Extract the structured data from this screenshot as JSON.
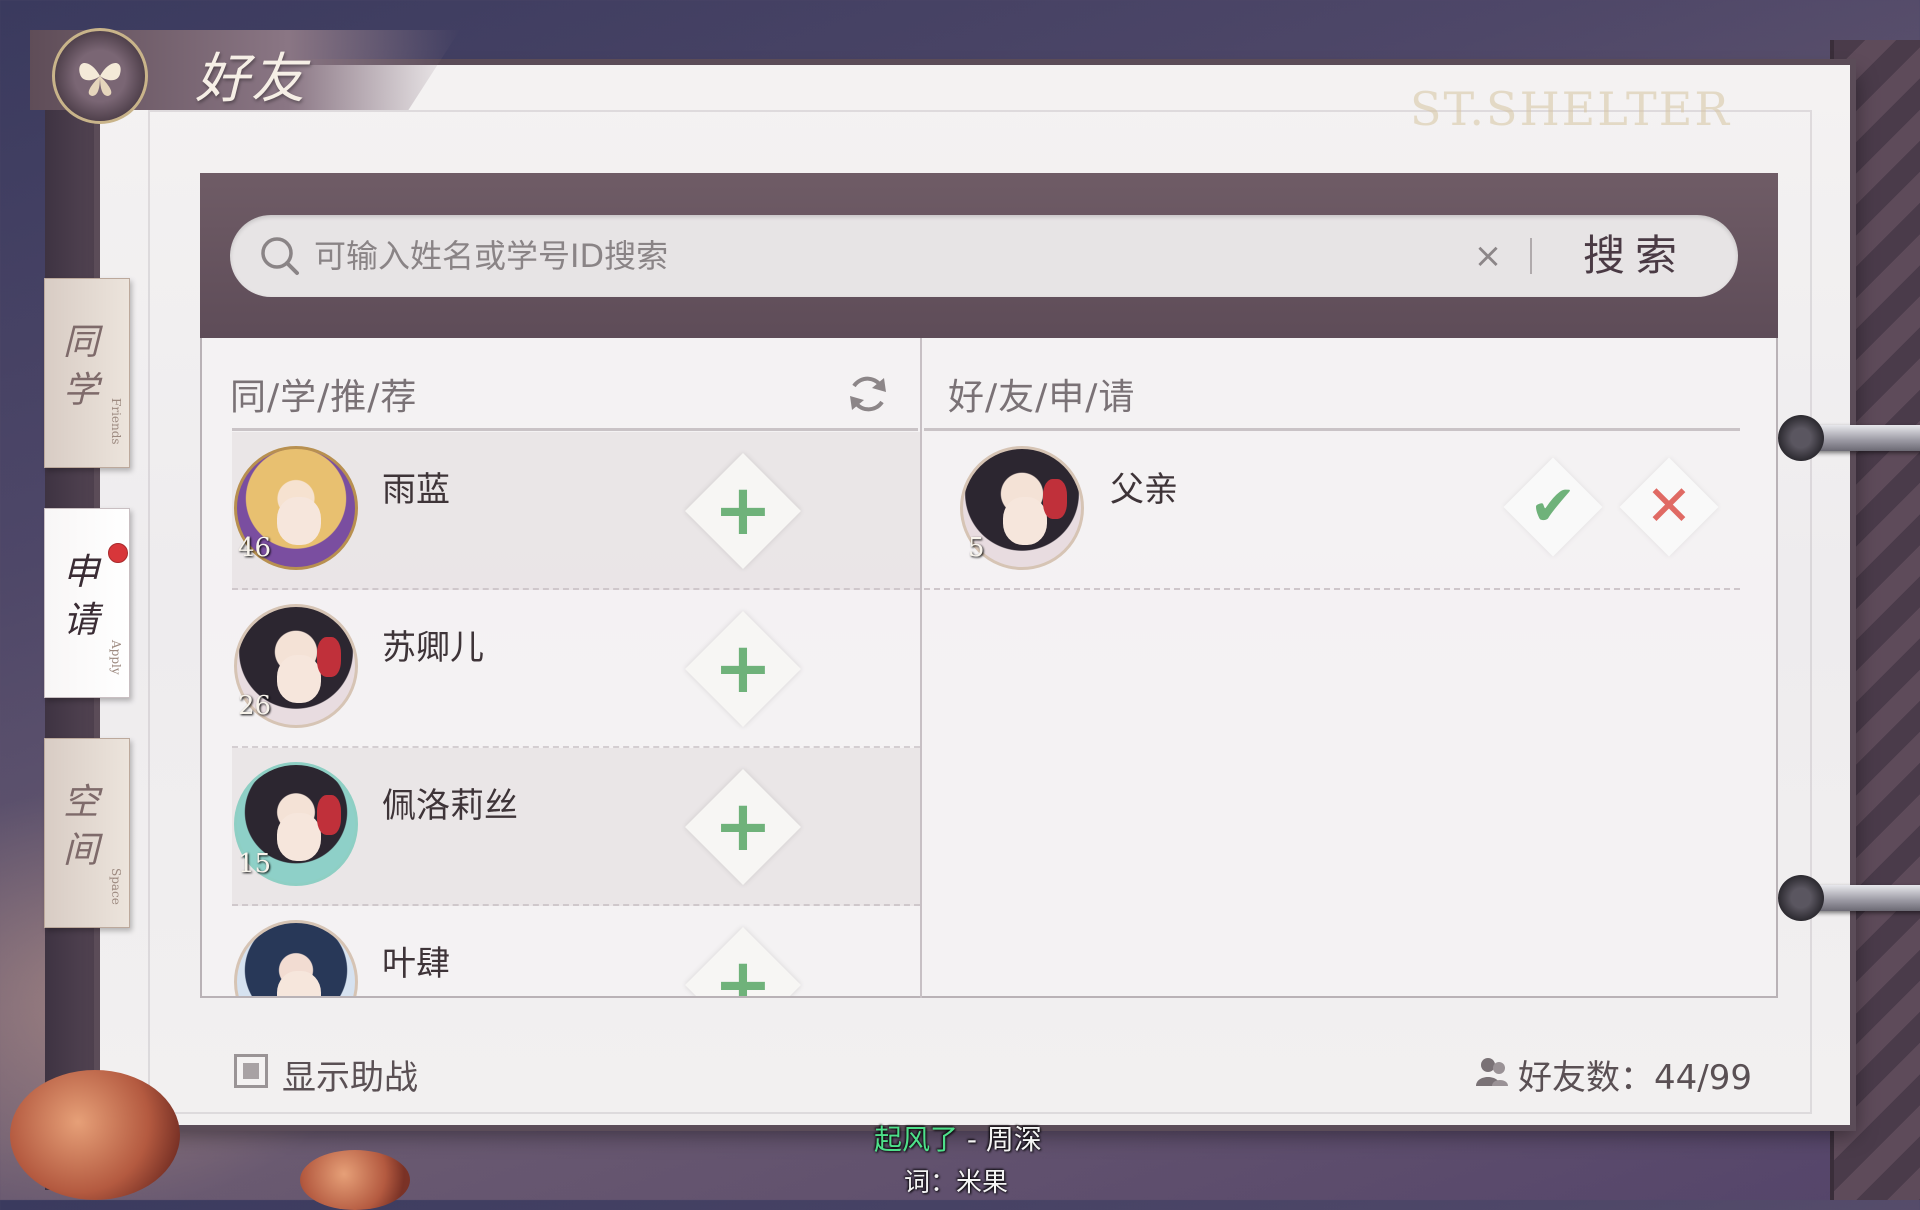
{
  "screen": {
    "title": "好友",
    "logo_text": "ST.SHELTER"
  },
  "side_tabs": [
    {
      "label_cn": "同学",
      "label_en": "Friends",
      "active": false
    },
    {
      "label_cn": "申请",
      "label_en": "Apply",
      "active": true,
      "notification": true
    },
    {
      "label_cn": "空间",
      "label_en": "Space",
      "active": false
    }
  ],
  "search": {
    "placeholder": "可输入姓名或学号ID搜索",
    "clear_icon": "close-icon",
    "button_label": "搜索"
  },
  "recommend": {
    "title": "同/学/推/荐",
    "refresh_icon": "refresh-icon",
    "items": [
      {
        "name": "雨蓝",
        "level": "46",
        "avatar": "blond-halloween",
        "action_icon": "plus-icon"
      },
      {
        "name": "苏卿儿",
        "level": "26",
        "avatar": "dark-hair-red-flower",
        "action_icon": "plus-icon"
      },
      {
        "name": "佩洛莉丝",
        "level": "15",
        "avatar": "dark-hair-candy-frame",
        "action_icon": "plus-icon"
      },
      {
        "name": "叶肆",
        "level": "",
        "avatar": "blue-hair-cat-frame",
        "action_icon": "plus-icon"
      }
    ]
  },
  "requests": {
    "title": "好/友/申/请",
    "items": [
      {
        "name": "父亲",
        "level": "5",
        "avatar": "dark-hair-red-flower",
        "accept_icon": "check-icon",
        "reject_icon": "close-icon"
      }
    ]
  },
  "footer": {
    "show_assist_label": "显示助战",
    "show_assist_checked": true,
    "friend_count_label": "好友数：",
    "friend_count_value": "44/99"
  },
  "lyrics": {
    "line1_highlight": "起风了",
    "line1_rest": " - 周深",
    "line2": "词：米果"
  },
  "colors": {
    "accent_green": "#6fb27a",
    "reject_red": "#e06a64",
    "header_purple": "#6f5c66",
    "notification_red": "#d8363a"
  }
}
